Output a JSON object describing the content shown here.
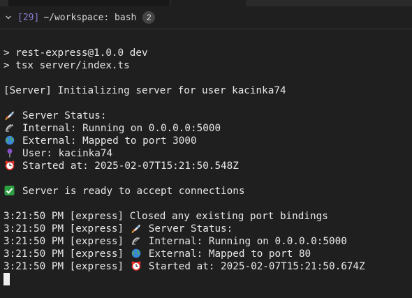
{
  "header": {
    "session_id": "[29]",
    "title": "~/workspace: bash",
    "badge_count": "2"
  },
  "colors": {
    "background": "#1f1f1f",
    "text": "#e8e8e8",
    "session_id": "#8c7fd6",
    "check_green": "#2ea043"
  },
  "terminal": {
    "cmd1": "> rest-express@1.0.0 dev",
    "cmd2": "> tsx server/index.ts",
    "init": "[Server] Initializing server for user kacinka74",
    "status_title": "Server Status:",
    "internal": "Internal: Running on 0.0.0.0:5000",
    "external": "External: Mapped to port 3000",
    "user": "User: kacinka74",
    "started": "Started at: 2025-02-07T15:21:50.548Z",
    "ready": "Server is ready to accept connections",
    "log_prefix": "3:21:50 PM [express] ",
    "log1": "Closed any existing port bindings",
    "log2": "Server Status:",
    "log3": "Internal: Running on 0.0.0.0:5000",
    "log4": "External: Mapped to port 80",
    "log5": "Started at: 2025-02-07T15:21:50.674Z"
  },
  "icons": {
    "rocket": "rocket-icon",
    "satellite": "satellite-icon",
    "globe": "globe-icon",
    "pin": "pin-icon",
    "alarm": "alarm-clock-icon",
    "check": "check-mark-icon",
    "chevron": "chevron-down-icon"
  }
}
